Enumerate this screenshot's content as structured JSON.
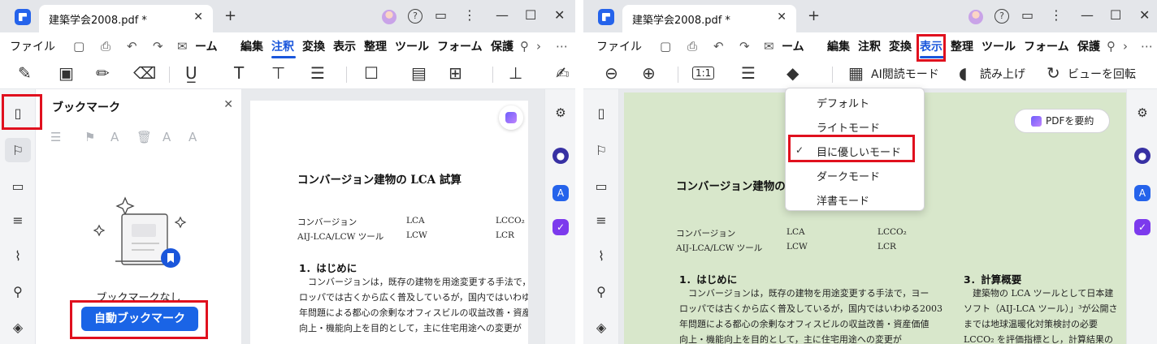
{
  "window": {
    "tab_title": "建築学会2008.pdf *",
    "new_tab": "+",
    "controls": [
      "⋮",
      "—",
      "☐",
      "✕"
    ]
  },
  "menu": {
    "file": "ファイル",
    "left_items": [
      "ホーム",
      "編集",
      "注釈",
      "変換",
      "表示",
      "整理",
      "ツール",
      "フォーム",
      "保護"
    ],
    "left_visible": [
      "ーム",
      "編集",
      "注釈",
      "変換",
      "表示",
      "整理",
      "ツール",
      "フォーム",
      "保護"
    ],
    "right_visible": [
      "ーム",
      "編集",
      "注釈",
      "変換",
      "表示",
      "整理",
      "ツール",
      "フォーム",
      "保護"
    ],
    "active_left": "注釈",
    "active_right": "表示"
  },
  "toolbar_right": {
    "ratio": "1:1",
    "ai_read_mode": "AI閲読モード",
    "read_aloud": "読み上げ",
    "rotate_view": "ビューを回転"
  },
  "bookmark_panel": {
    "title": "ブックマーク",
    "empty_text": "ブックマークなし",
    "auto_button": "自動ブックマーク"
  },
  "document": {
    "title": "コンバージョン建物の LCA 試算",
    "title_cut": "コンバージョン建物の",
    "keywords_row1": [
      "コンバージョン",
      "LCA",
      "LCCO₂"
    ],
    "keywords_row2": [
      "AIJ-LCA/LCW ツール",
      "LCW",
      "LCR"
    ],
    "section1": "1．はじめに",
    "section3": "3．計算概要",
    "para_left": [
      "　コンバージョンは，既存の建物を用途変更する手法で，ヨー",
      "ロッパでは古くから広く普及しているが，国内ではいわゆる2003",
      "年問題による都心の余剰なオフィスビルの収益改善・資産価値",
      "向上・機能向上を目的として，主に住宅用途への変更が"
    ],
    "para_right": [
      "　建築物の LCA ツールとして日本建",
      "ソフト（AIJ-LCA ツール）」³が公開さ",
      "までは地球温暖化対策検討の必要",
      "LCCO₂ を評価指標とし，計算結果の"
    ],
    "pdf_summary": "PDFを要約"
  },
  "display_mode_menu": {
    "items": [
      "デフォルト",
      "ライトモード",
      "目に優しいモード",
      "ダークモード",
      "洋書モード"
    ],
    "selected": "目に優しいモード",
    "check": "✓"
  },
  "colors": {
    "accent": "#1a56db",
    "button_blue": "#1a64e6",
    "highlight_red": "#e0101e",
    "eye_care_bg": "#d8e7cb",
    "titlebar": "#e4e6ea"
  }
}
